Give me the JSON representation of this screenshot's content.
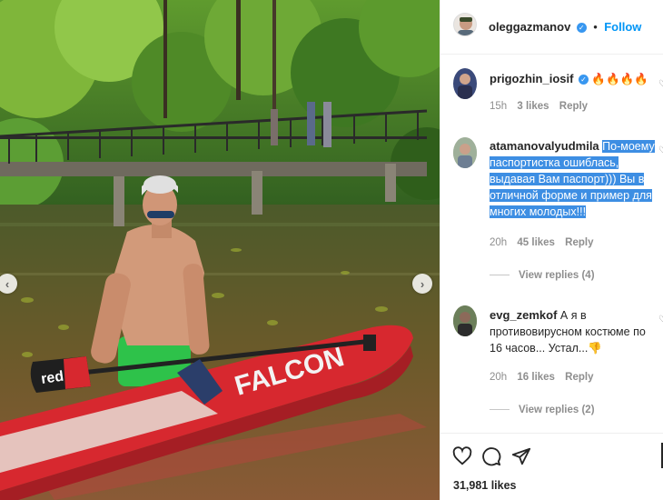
{
  "post": {
    "author": "oleggazmanov",
    "follow_label": "Follow",
    "separator": "•",
    "photo": {
      "board_text": "FALCON",
      "paddle_text": "red",
      "prev_glyph": "‹",
      "next_glyph": "›"
    }
  },
  "comments": [
    {
      "user": "prigozhin_iosif",
      "verified": true,
      "text": "🔥🔥🔥🔥",
      "time": "15h",
      "likes": "3 likes",
      "reply_label": "Reply"
    },
    {
      "user": "atamanovalyudmila",
      "verified": false,
      "text_lines": [
        "По-моему",
        "паспортистка ошиблась,",
        "выдавая Вам паспорт))) Вы в",
        "отличной форме и пример для",
        "многих молодых!!!"
      ],
      "time": "20h",
      "likes": "45 likes",
      "reply_label": "Reply",
      "view_replies": "View replies (4)"
    },
    {
      "user": "evg_zemkof",
      "verified": false,
      "text_lines": [
        "А я в",
        "противовирусном костюме по",
        "16 часов... Устал...👎"
      ],
      "time": "20h",
      "likes": "16 likes",
      "reply_label": "Reply",
      "view_replies": "View replies (2)"
    }
  ],
  "footer": {
    "likes": "31,981 likes",
    "icons": [
      "heart-icon",
      "comment-icon",
      "share-icon"
    ]
  },
  "colors": {
    "link": "#0095f6",
    "selection": "#3d8ee3",
    "muted": "#8e8e8e",
    "board": "#d7282f"
  }
}
